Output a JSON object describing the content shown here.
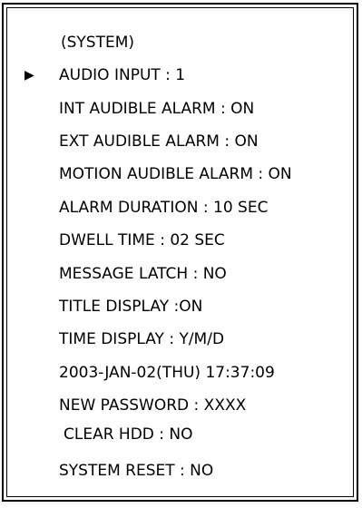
{
  "menu": {
    "title": "(SYSTEM)",
    "selector_icon": "▶",
    "items": [
      {
        "label": "AUDIO INPUT : 1"
      },
      {
        "label": "INT AUDIBLE ALARM : ON"
      },
      {
        "label": "EXT AUDIBLE ALARM : ON"
      },
      {
        "label": "MOTION AUDIBLE ALARM : ON"
      },
      {
        "label": "ALARM DURATION : 10 SEC"
      },
      {
        "label": "DWELL TIME : 02 SEC"
      },
      {
        "label": "MESSAGE LATCH : NO"
      },
      {
        "label": "TITLE DISPLAY :ON"
      },
      {
        "label": "TIME DISPLAY : Y/M/D"
      },
      {
        "label": "2003-JAN-02(THU) 17:37:09"
      },
      {
        "label": "NEW PASSWORD : XXXX"
      },
      {
        "label": "CLEAR HDD : NO"
      },
      {
        "label": "SYSTEM RESET : NO"
      }
    ]
  },
  "colors": {
    "background": "#ffffff",
    "text": "#000000",
    "border": "#000000"
  }
}
